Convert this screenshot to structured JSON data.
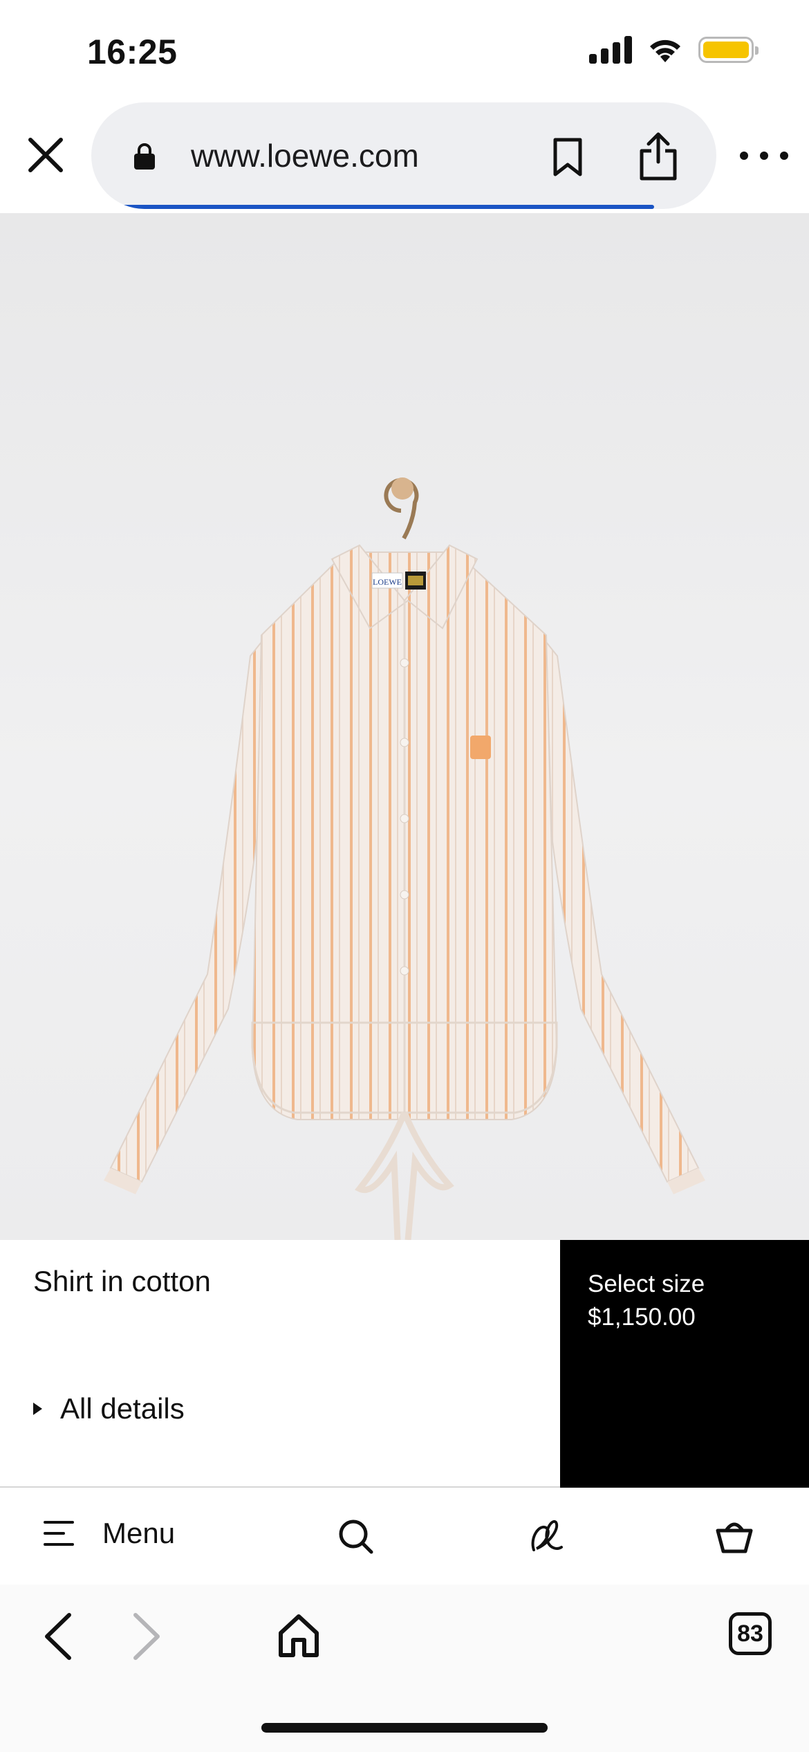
{
  "status_bar": {
    "time": "16:25",
    "icons": [
      "cellular-signal-icon",
      "wifi-icon",
      "battery-icon"
    ],
    "battery_color": "#f6c400"
  },
  "browser": {
    "url": "www.loewe.com",
    "icons": [
      "close-icon",
      "lock-icon",
      "bookmark-icon",
      "share-icon",
      "more-icon"
    ],
    "progress_color": "#1a54c4",
    "tabs_count": "83"
  },
  "product": {
    "image_label": "LOEWE",
    "title": "Shirt in cotton",
    "details_label": "All details",
    "select_size_label": "Select size",
    "price": "$1,150.00"
  },
  "site_nav": {
    "menu_label": "Menu",
    "icons": [
      "menu-icon",
      "search-icon",
      "wishlist-icon",
      "bag-icon"
    ]
  },
  "bottom_toolbar": {
    "icons": [
      "back-icon",
      "forward-icon",
      "home-icon",
      "tabs-icon"
    ]
  }
}
